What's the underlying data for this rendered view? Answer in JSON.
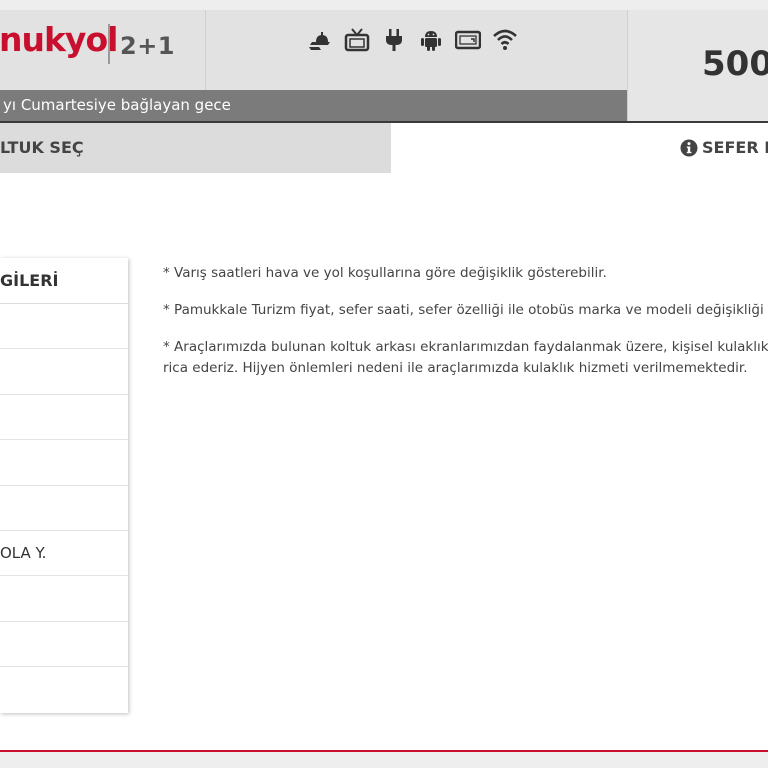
{
  "header": {
    "logo_text": "nukyol",
    "seat_type": "2+1",
    "date_text": "yı Cumartesiye bağlayan gece",
    "price": "500",
    "amenity_icons": [
      "food-service-icon",
      "tv-icon",
      "power-plug-icon",
      "android-icon",
      "screen-icon",
      "wifi-icon"
    ]
  },
  "tabs": {
    "select_seat": "LTUK SEÇ",
    "trip_info": "SEFER B"
  },
  "info_panel": {
    "title": "GİLERİ",
    "rows": [
      "",
      "",
      "",
      "",
      "",
      "OLA Y.",
      "",
      "",
      ""
    ]
  },
  "notes": [
    "* Varış saatleri hava ve yol koşullarına göre değişiklik gösterebilir.",
    "* Pamukkale Turizm fiyat, sefer saati, sefer özelliği ile otobüs marka ve modeli değişikliği",
    "* Araçlarımızda bulunan koltuk arkası ekranlarımızdan faydalanmak üzere, kişisel kulaklık",
    "rica ederiz. Hijyen önlemleri nedeni ile araçlarımızda kulaklık hizmeti verilmemektedir."
  ],
  "colors": {
    "brand_red": "#c8102e",
    "date_bar": "#7b7b7b",
    "header_bg": "#e2e2e2"
  }
}
